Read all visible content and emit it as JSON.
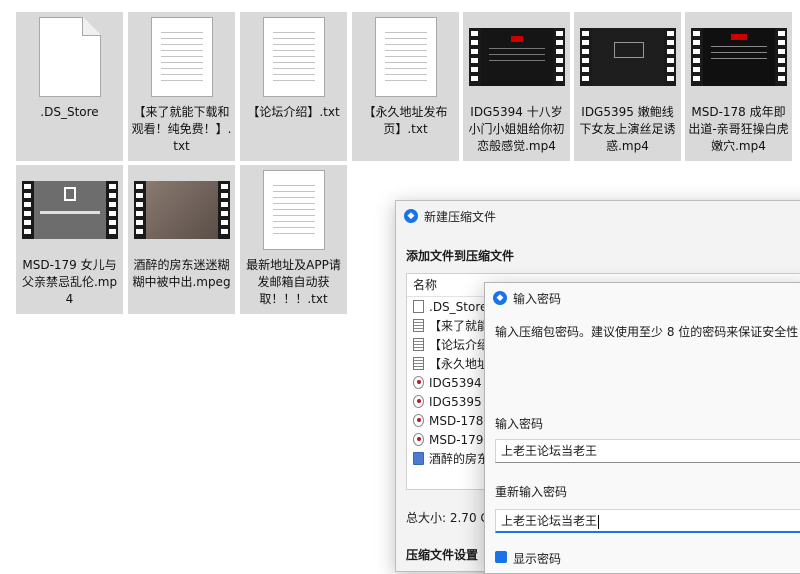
{
  "files": [
    {
      "name": ".DS_Store",
      "kind": "blank"
    },
    {
      "name": "【来了就能下载和观看！纯免费！】.txt",
      "kind": "txt"
    },
    {
      "name": "【论坛介绍】.txt",
      "kind": "txt"
    },
    {
      "name": "【永久地址发布页】.txt",
      "kind": "txt"
    },
    {
      "name": "IDG5394 十八岁小门小姐姐给你初恋般感觉.mp4",
      "kind": "video"
    },
    {
      "name": "IDG5395 嫩鲍线下女友上演丝足诱惑.mp4",
      "kind": "video"
    },
    {
      "name": "MSD-178 成年即出道-亲哥狂操白虎嫩穴.mp4",
      "kind": "video"
    },
    {
      "name": "MSD-179 女儿与父亲禁忌乱伦.mp4",
      "kind": "video"
    },
    {
      "name": "酒醉的房东迷迷糊糊中被中出.mpeg",
      "kind": "video"
    },
    {
      "name": "最新地址及APP请发邮箱自动获取！！！.txt",
      "kind": "txt"
    }
  ],
  "archive_window": {
    "title": "新建压缩文件",
    "section_title": "添加文件到压缩文件",
    "list_header": "名称",
    "list_items": [
      {
        "label": ".DS_Store",
        "icon": "file-icon"
      },
      {
        "label": "【来了就能",
        "icon": "txt-icon"
      },
      {
        "label": "【论坛介绍",
        "icon": "txt-icon"
      },
      {
        "label": "【永久地址",
        "icon": "txt-icon"
      },
      {
        "label": "IDG5394 -",
        "icon": "video-icon"
      },
      {
        "label": "IDG5395 娇",
        "icon": "video-icon"
      },
      {
        "label": "MSD-178",
        "icon": "video-icon"
      },
      {
        "label": "MSD-179",
        "icon": "video-icon"
      },
      {
        "label": "酒醉的房东",
        "icon": "mpeg-icon"
      }
    ],
    "total_size": "总大小: 2.70 G",
    "settings_label": "压缩文件设置"
  },
  "password_dialog": {
    "title": "输入密码",
    "description": "输入压缩包密码。建议使用至少 8 位的密码来保证安全性",
    "password_label": "输入密码",
    "password_value": "上老王论坛当老王",
    "confirm_label": "重新输入密码",
    "confirm_value": "上老王论坛当老王",
    "show_password_label": "显示密码"
  },
  "colors": {
    "accent": "#1a73e8",
    "tile_bg": "#d9d9d9"
  }
}
